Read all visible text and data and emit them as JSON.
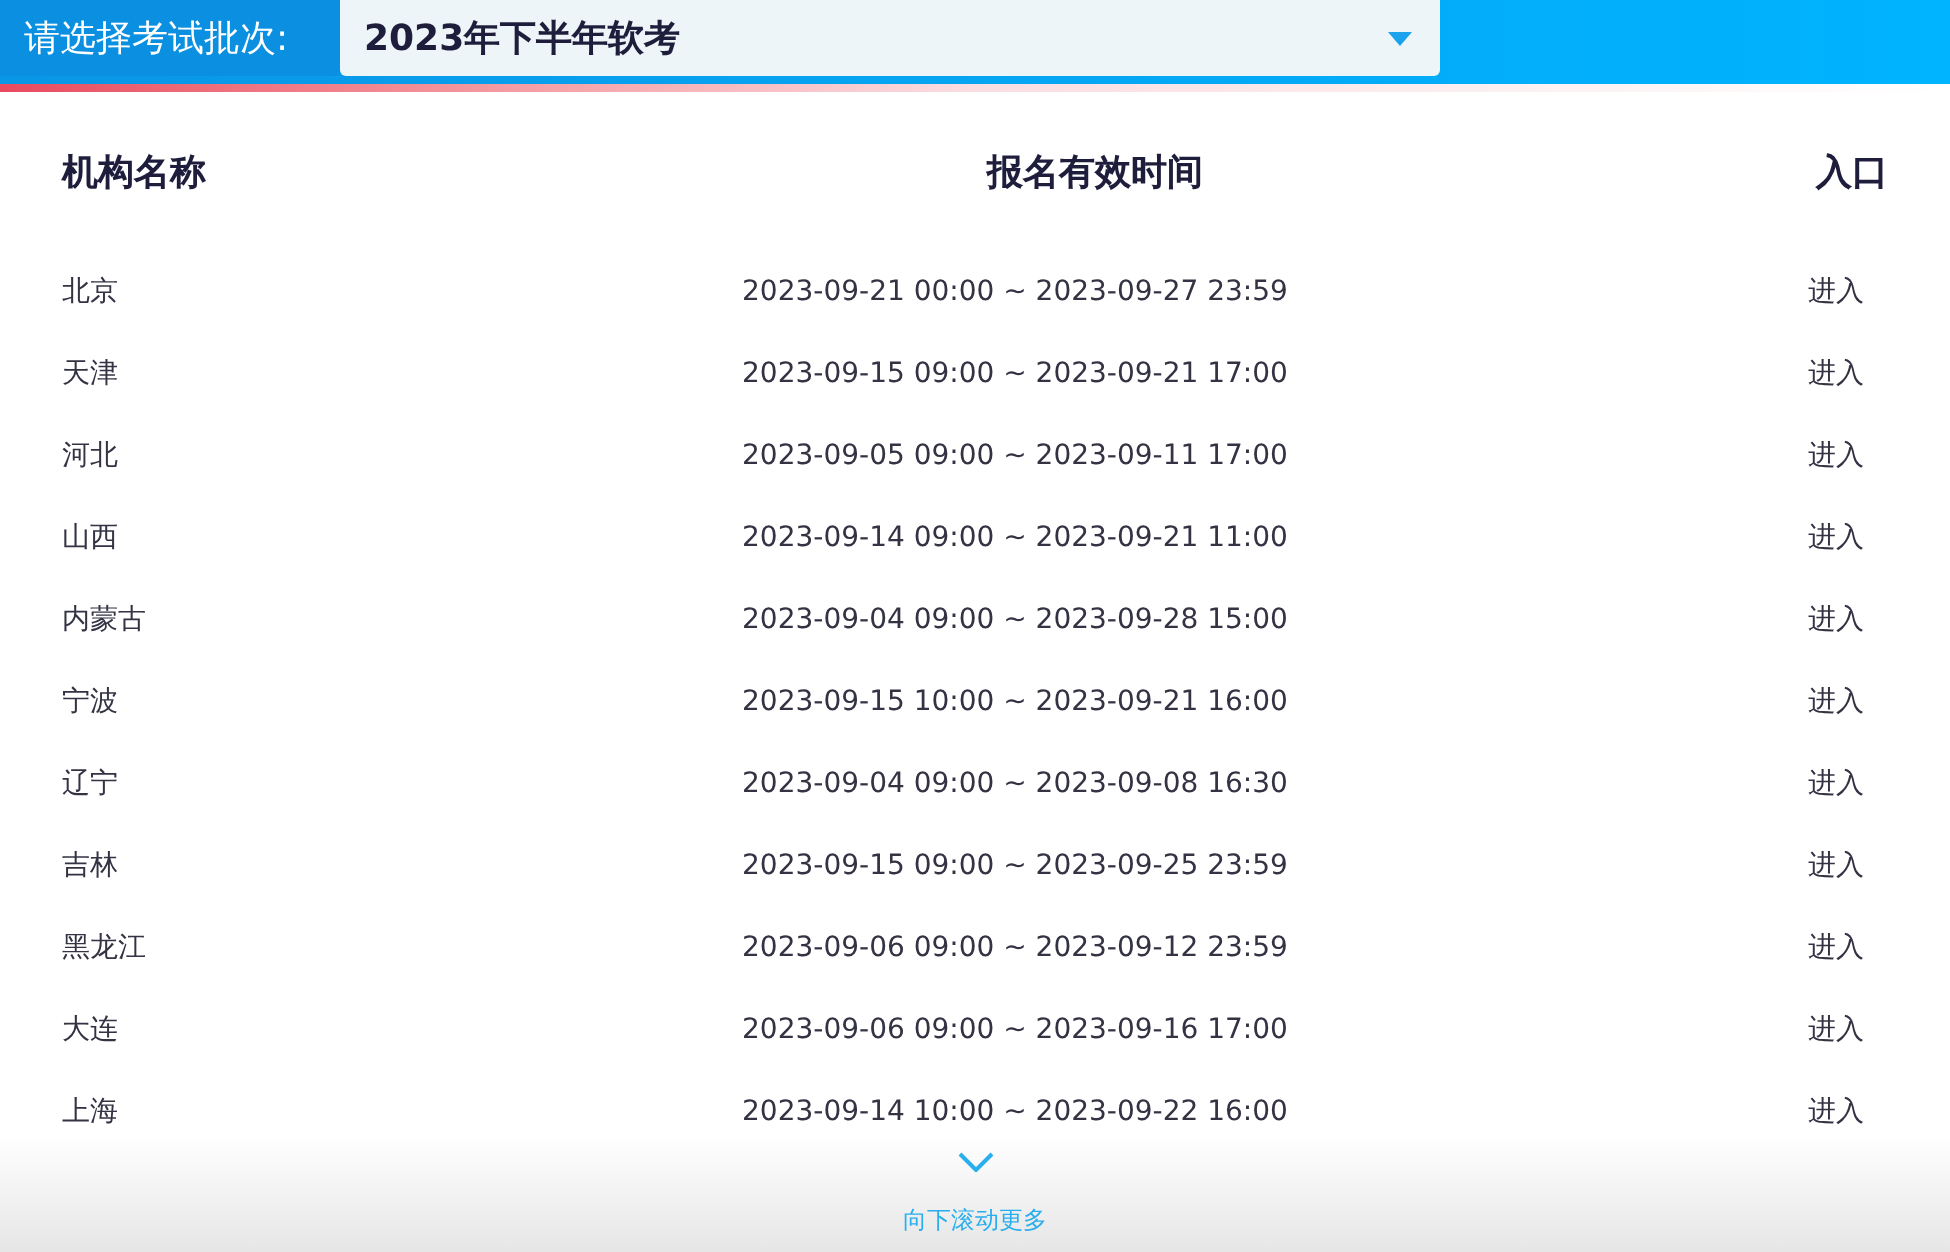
{
  "header": {
    "label": "请选择考试批次:",
    "select_value": "2023年下半年软考"
  },
  "table": {
    "columns": [
      "机构名称",
      "报名有效时间",
      "入口"
    ],
    "rows": [
      {
        "name": "北京",
        "time": "2023-09-21 00:00 ~ 2023-09-27 23:59",
        "entry": "进入"
      },
      {
        "name": "天津",
        "time": "2023-09-15 09:00 ~ 2023-09-21 17:00",
        "entry": "进入"
      },
      {
        "name": "河北",
        "time": "2023-09-05 09:00 ~ 2023-09-11 17:00",
        "entry": "进入"
      },
      {
        "name": "山西",
        "time": "2023-09-14 09:00 ~ 2023-09-21 11:00",
        "entry": "进入"
      },
      {
        "name": "内蒙古",
        "time": "2023-09-04 09:00 ~ 2023-09-28 15:00",
        "entry": "进入"
      },
      {
        "name": "宁波",
        "time": "2023-09-15 10:00 ~ 2023-09-21 16:00",
        "entry": "进入"
      },
      {
        "name": "辽宁",
        "time": "2023-09-04 09:00 ~ 2023-09-08 16:30",
        "entry": "进入"
      },
      {
        "name": "吉林",
        "time": "2023-09-15 09:00 ~ 2023-09-25 23:59",
        "entry": "进入"
      },
      {
        "name": "黑龙江",
        "time": "2023-09-06 09:00 ~ 2023-09-12 23:59",
        "entry": "进入"
      },
      {
        "name": "大连",
        "time": "2023-09-06 09:00 ~ 2023-09-16 17:00",
        "entry": "进入"
      },
      {
        "name": "上海",
        "time": "2023-09-14 10:00 ~ 2023-09-22 16:00",
        "entry": "进入"
      }
    ]
  },
  "scroll_hint": "向下滚动更多"
}
